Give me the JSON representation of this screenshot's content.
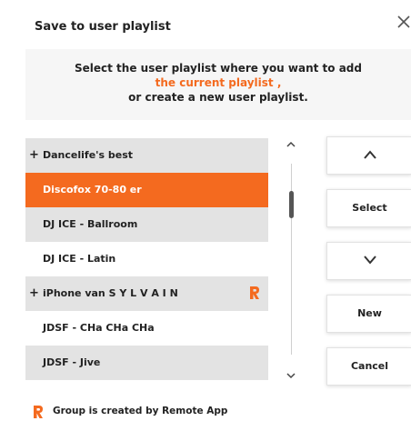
{
  "dialog": {
    "title": "Save to user playlist",
    "close_glyph": "✕"
  },
  "instructions": {
    "line1": "Select the user playlist where you want to add",
    "line2": "the current playlist ,",
    "line3": "or create a new user playlist."
  },
  "playlists": [
    {
      "label": "Dancelife's best",
      "group": true,
      "plus": "+",
      "remote": false,
      "selected": false
    },
    {
      "label": "Discofox 70-80 er",
      "group": false,
      "remote": false,
      "selected": true
    },
    {
      "label": "DJ ICE - Ballroom",
      "group": false,
      "remote": false,
      "selected": false
    },
    {
      "label": "DJ ICE - Latin",
      "group": false,
      "remote": false,
      "selected": false
    },
    {
      "label": "iPhone van S Y L V A I N",
      "group": true,
      "plus": "+",
      "remote": true,
      "selected": false
    },
    {
      "label": "JDSF - CHa CHa CHa",
      "group": false,
      "remote": false,
      "selected": false
    },
    {
      "label": "JDSF - Jive",
      "group": false,
      "remote": false,
      "selected": false
    }
  ],
  "buttons": {
    "up_icon": "chevron-up-icon",
    "select": "Select",
    "down_icon": "chevron-down-icon",
    "new": "New",
    "cancel": "Cancel"
  },
  "scroll": {
    "up_icon": "chevron-up-icon",
    "down_icon": "chevron-down-icon"
  },
  "footer": {
    "text": "Group is created by Remote App"
  },
  "colors": {
    "accent": "#f46a1f",
    "row_grey": "#e3e3e3",
    "panel_bg": "#f6f6f6"
  }
}
